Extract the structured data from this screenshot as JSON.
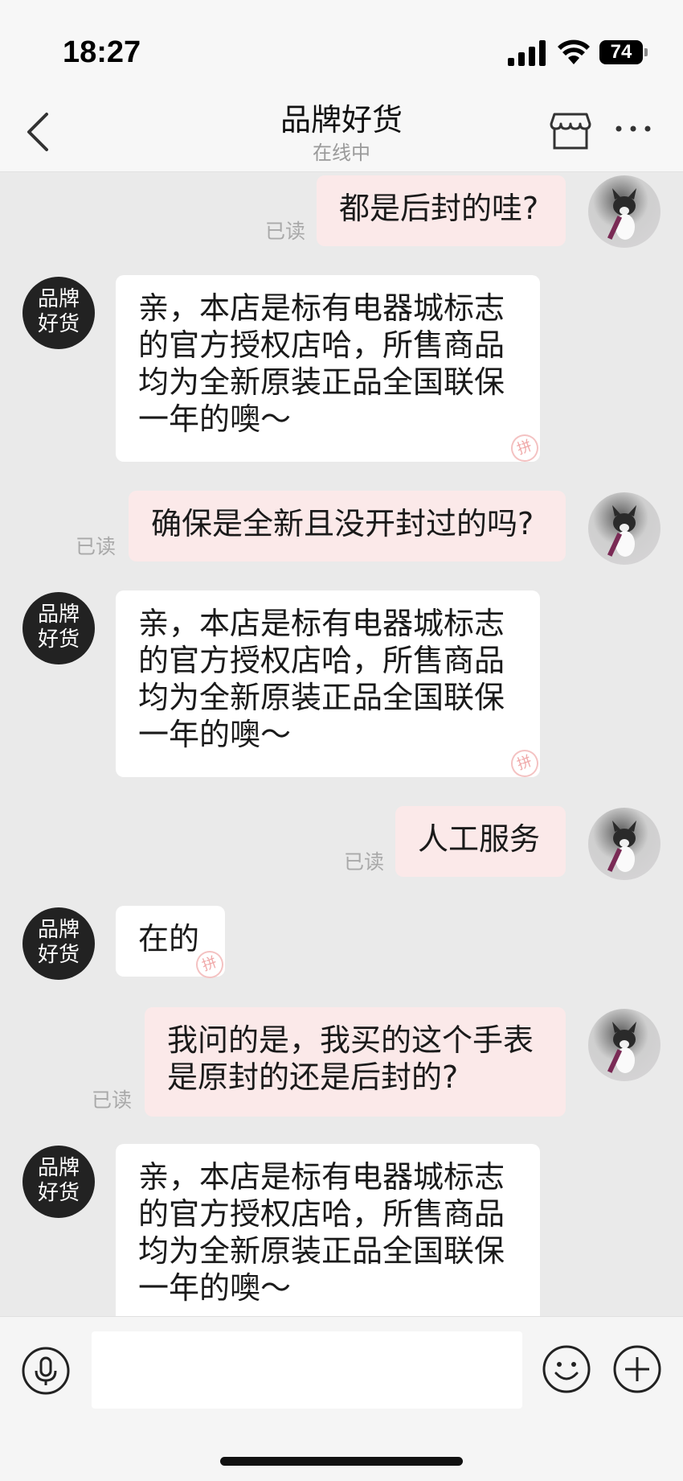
{
  "status": {
    "time": "18:27",
    "battery": "74"
  },
  "nav": {
    "title": "品牌好货",
    "subtitle": "在线中"
  },
  "shop_avatar_text": "品牌\n好货",
  "messages": [
    {
      "from": "user",
      "text": "都是后封的哇?",
      "read": "已读"
    },
    {
      "from": "shop",
      "text": "亲，本店是标有电器城标志\n的官方授权店哈，所售商品\n均为全新原装正品全国联保\n一年的噢～"
    },
    {
      "from": "user",
      "text": "确保是全新且没开封过的吗?",
      "read": "已读"
    },
    {
      "from": "shop",
      "text": "亲，本店是标有电器城标志\n的官方授权店哈，所售商品\n均为全新原装正品全国联保\n一年的噢～"
    },
    {
      "from": "user",
      "text": "人工服务",
      "read": "已读"
    },
    {
      "from": "shop",
      "text": "在的"
    },
    {
      "from": "user",
      "text": "我问的是，我买的这个手表\n是原封的还是后封的?",
      "read": "已读"
    },
    {
      "from": "shop",
      "text": "亲，本店是标有电器城标志\n的官方授权店哈，所售商品\n均为全新原装正品全国联保\n一年的噢～"
    }
  ],
  "watermark": "拼",
  "input": {
    "value": "",
    "placeholder": ""
  },
  "icons": [
    "back-icon",
    "shop-icon",
    "more-icon",
    "mic-icon",
    "emoji-icon",
    "plus-icon"
  ]
}
